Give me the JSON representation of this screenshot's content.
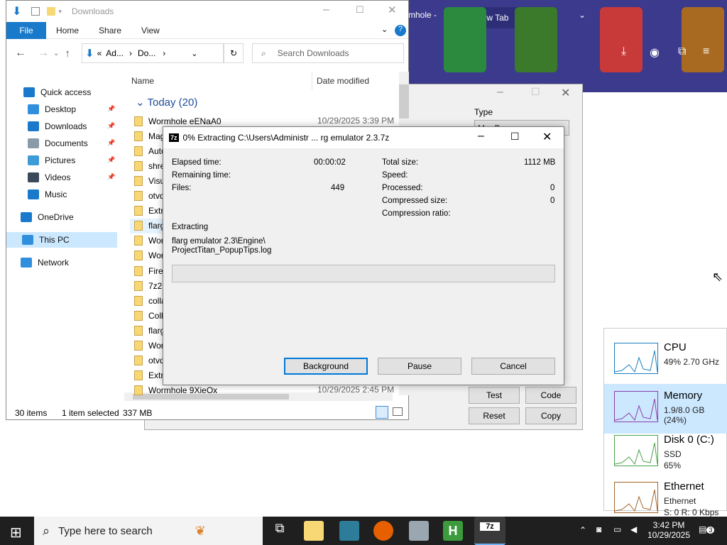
{
  "browser": {
    "tab_prefix": "mhole -",
    "new_tab": "New Tab"
  },
  "explorer": {
    "title": "Downloads",
    "ribbon": {
      "file": "File",
      "home": "Home",
      "share": "Share",
      "view": "View"
    },
    "address": {
      "part1": "Ad...",
      "part2": "Do...",
      "sep": "«",
      "search_placeholder": "Search Downloads"
    },
    "columns": {
      "name": "Name",
      "date": "Date modified"
    },
    "group": "Today (20)",
    "sidebar": [
      {
        "label": "Quick access",
        "icon": "star-icon"
      },
      {
        "label": "Desktop",
        "icon": "desktop-icon"
      },
      {
        "label": "Downloads",
        "icon": "download-icon"
      },
      {
        "label": "Documents",
        "icon": "documents-icon"
      },
      {
        "label": "Pictures",
        "icon": "pictures-icon"
      },
      {
        "label": "Videos",
        "icon": "videos-icon"
      },
      {
        "label": "Music",
        "icon": "music-icon"
      },
      {
        "label": "OneDrive",
        "icon": "cloud-icon"
      },
      {
        "label": "This PC",
        "icon": "pc-icon"
      },
      {
        "label": "Network",
        "icon": "network-icon"
      }
    ],
    "files": [
      "Wormhole eENaA0",
      "Mag",
      "Auto",
      "shre",
      "Visu",
      "otvd",
      "Extra",
      "flarg",
      "Worn",
      "Worm",
      "Firef",
      "7z25",
      "colla",
      "Colla",
      "flarg",
      "Worm",
      "otvd",
      "Extra",
      "Wormhole 9XieOx"
    ],
    "dates": {
      "first": "10/29/2025 3:39 PM",
      "last": "10/29/2025 2:45 PM"
    },
    "status": {
      "items": "30 items",
      "selected": "1 item selected",
      "size": "337 MB"
    }
  },
  "zip": {
    "title": "0% Extracting C:\\Users\\Administr ... rg emulator 2.3.7z",
    "elapsed_label": "Elapsed time:",
    "elapsed": "00:00:02",
    "remaining_label": "Remaining time:",
    "files_label": "Files:",
    "files": "449",
    "total_label": "Total size:",
    "total": "1112 MB",
    "speed_label": "Speed:",
    "processed_label": "Processed:",
    "processed": "0",
    "compressed_label": "Compressed size:",
    "compressed": "0",
    "ratio_label": "Compression ratio:",
    "extracting_label": "Extracting",
    "path1": "flarg emulator 2.3\\Engine\\",
    "path2": "ProjectTitan_PopupTips.log",
    "progress": 0,
    "btn_background": "Background",
    "btn_pause": "Pause",
    "btn_cancel": "Cancel"
  },
  "backdlg": {
    "type_label": "Type",
    "type_value": "MonPov",
    "test": "Test",
    "code": "Code",
    "reset": "Reset",
    "copy": "Copy"
  },
  "taskmgr": [
    {
      "name": "CPU",
      "sub1": "49%  2.70 GHz",
      "color": "#1a7fbf"
    },
    {
      "name": "Memory",
      "sub1": "1.9/8.0 GB (24%)",
      "color": "#8b3fa6"
    },
    {
      "name": "Disk 0 (C:)",
      "sub1": "SSD",
      "sub2": "65%",
      "color": "#4aa14a"
    },
    {
      "name": "Ethernet",
      "sub1": "Ethernet",
      "sub2": "S: 0  R: 0 Kbps",
      "color": "#a0642a"
    }
  ],
  "taskbar": {
    "search": "Type here to search",
    "time": "3:42 PM",
    "date": "10/29/2025",
    "notif": "3"
  }
}
